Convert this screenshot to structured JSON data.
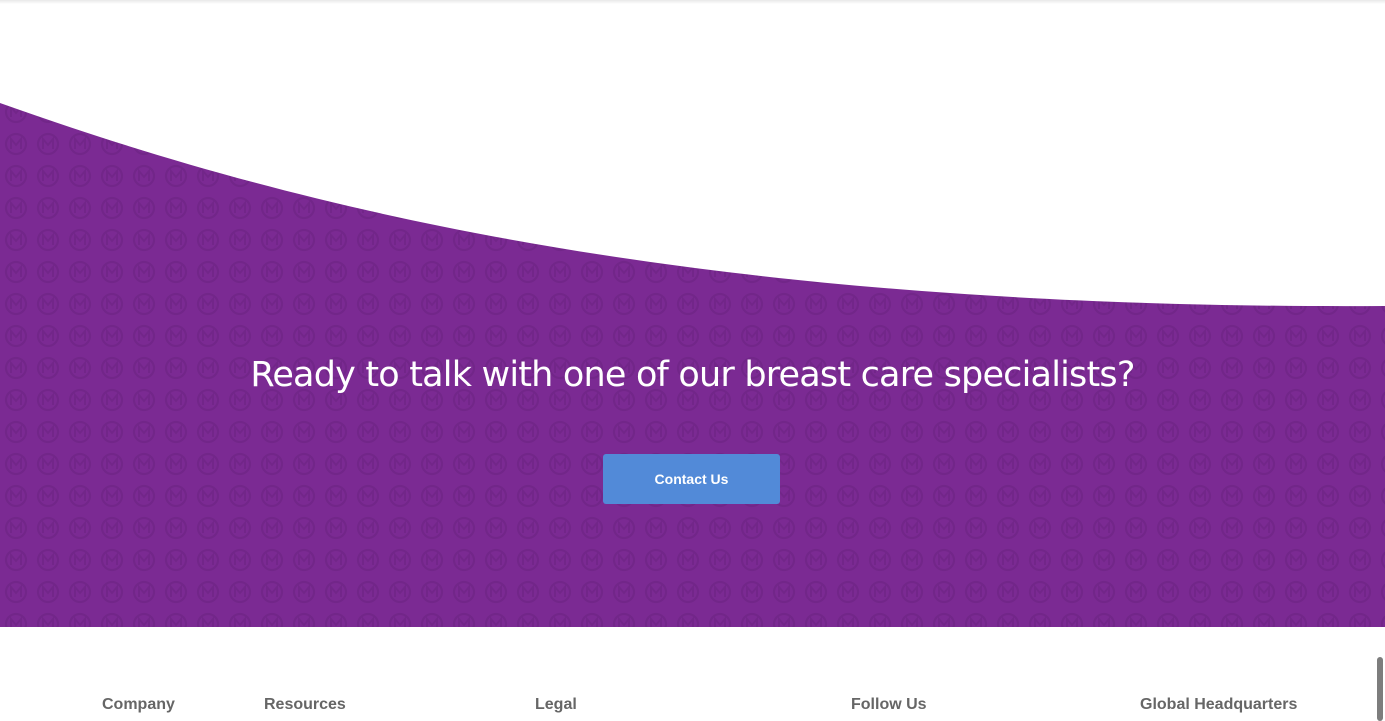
{
  "cta": {
    "heading": "Ready to talk with one of our breast care specialists?",
    "button_label": "Contact Us",
    "colors": {
      "background": "#7b2a93",
      "pattern": "#722689",
      "button": "#528ad8"
    }
  },
  "footer": {
    "columns": [
      {
        "label": "Company"
      },
      {
        "label": "Resources"
      },
      {
        "label": "Legal"
      },
      {
        "label": "Follow Us"
      },
      {
        "label": "Global Headquarters"
      }
    ]
  }
}
